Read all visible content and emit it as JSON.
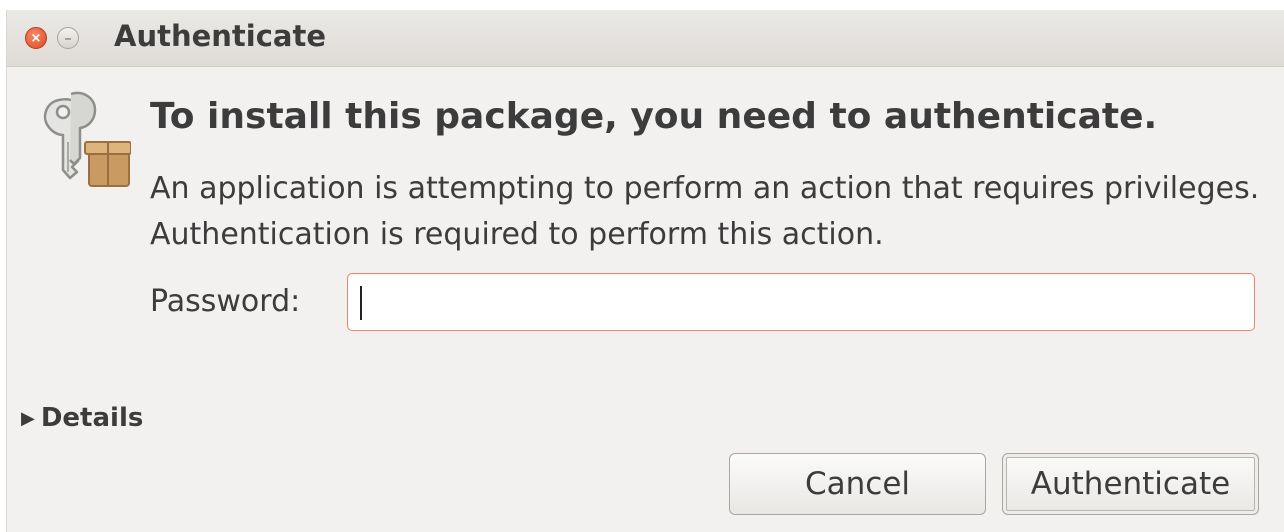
{
  "window": {
    "title": "Authenticate",
    "close_glyph": "×",
    "minimize_glyph": "–"
  },
  "dialog": {
    "icon": "keys-package-icon",
    "heading": "To install this package, you need to authenticate.",
    "description": "An application is attempting to perform an action that requires privileges. Authentication is required to perform this action.",
    "password_label": "Password:",
    "password_value": "",
    "details_arrow": "▶",
    "details_label": "Details"
  },
  "buttons": {
    "cancel": "Cancel",
    "authenticate": "Authenticate"
  },
  "colors": {
    "close_button": "#df4a20",
    "input_focus_border": "#e68a6a",
    "window_background": "#f2f1f0"
  }
}
